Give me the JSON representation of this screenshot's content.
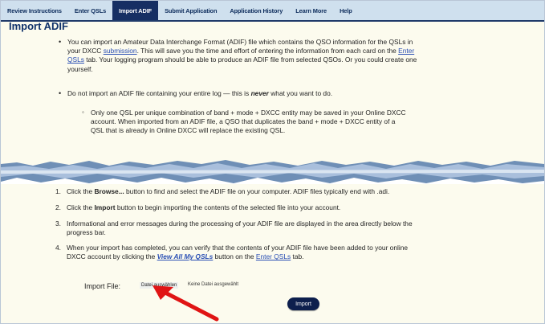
{
  "tabs": [
    {
      "label": "Review Instructions"
    },
    {
      "label": "Enter QSLs"
    },
    {
      "label": "Import ADIF",
      "active": true
    },
    {
      "label": "Submit Application"
    },
    {
      "label": "Application History"
    },
    {
      "label": "Learn More"
    },
    {
      "label": "Help"
    }
  ],
  "page": {
    "title": "Import ADIF",
    "bullets": {
      "b1": {
        "l1": "You can import an Amateur Data Interchange Format (ADIF) file which contains the QSO information for the QSLs in",
        "l2_a": "your DXCC ",
        "l2_link": "submission",
        "l2_b": ". This will save you the time and effort of entering the information from each card on the ",
        "l2_link2": "Enter",
        "l3_link": "QSLs",
        "l3_b": " tab. Your logging program should be able to produce an ADIF file from selected QSOs. Or you could create one",
        "l4": "yourself."
      },
      "b2": {
        "text_a": "Do not import an ADIF file containing your entire log — this is ",
        "never": "never",
        "text_b": " what you want to do."
      },
      "b3": {
        "l1": "Only one QSL per unique combination of band + mode + DXCC entity may be saved in your Online DXCC",
        "l2": "account. When imported from an ADIF file, a QSO that duplicates the band + mode + DXCC entity of a",
        "l3": "QSL that is already in Online DXCC will replace the existing QSL."
      }
    },
    "steps": [
      {
        "n": "1.",
        "l1_a": "Click the ",
        "l1_b": "Browse...",
        "l1_c": " button to find and select the ADIF file on your computer. ADIF files typically end with .adi."
      },
      {
        "n": "2.",
        "l1_a": "Click the ",
        "l1_b": "Import",
        "l1_c": " button to begin importing the contents of the selected file into your account."
      },
      {
        "n": "3.",
        "l1": "Informational and error messages during the processing of your ADIF file are displayed in the area directly below the",
        "l2": "progress bar."
      },
      {
        "n": "4.",
        "l1": "When your import has completed, you can verify that the contents of your ADIF file have been added to your online",
        "l2_a": "DXCC account by clicking the ",
        "l2_link": "View All My QSLs",
        "l2_b": " button on the ",
        "l2_link2": "Enter QSLs",
        "l2_c": " tab."
      }
    ],
    "import_file": {
      "label": "Import File:",
      "choose": "Datei auswählen",
      "none": "Keine Datei ausgewählt",
      "import_button": "Import"
    }
  },
  "colors": {
    "tab_bg": "#cfe0ee",
    "tab_active": "#162f63",
    "panel_bg": "#fcfbee",
    "title": "#10326b",
    "link": "#2a4fb4",
    "arrow": "#e01414"
  },
  "icons": {
    "pointer": "red-arrow-icon"
  }
}
